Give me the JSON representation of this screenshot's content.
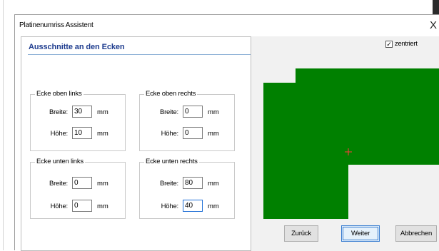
{
  "window": {
    "title": "Platinenumriss Assistent",
    "close_glyph": "X"
  },
  "section_heading": "Ausschnitte an den Ecken",
  "labels": {
    "width": "Breite:",
    "height": "Höhe:",
    "unit": "mm"
  },
  "corners": {
    "top_left": {
      "title": "Ecke oben links",
      "width": "30",
      "height": "10"
    },
    "top_right": {
      "title": "Ecke oben rechts",
      "width": "0",
      "height": "0"
    },
    "bottom_left": {
      "title": "Ecke unten links",
      "width": "0",
      "height": "0"
    },
    "bottom_right": {
      "title": "Ecke unten rechts",
      "width": "80",
      "height": "40"
    }
  },
  "centered_checkbox": {
    "label": "zentriert",
    "checked": true,
    "mark": "✓"
  },
  "preview": {
    "board_color": "#008000",
    "center_marker_color": "#ff3b3b",
    "background": "#f1f1f1"
  },
  "buttons": {
    "back": "Zurück",
    "next": "Weiter",
    "cancel": "Abbrechen"
  }
}
